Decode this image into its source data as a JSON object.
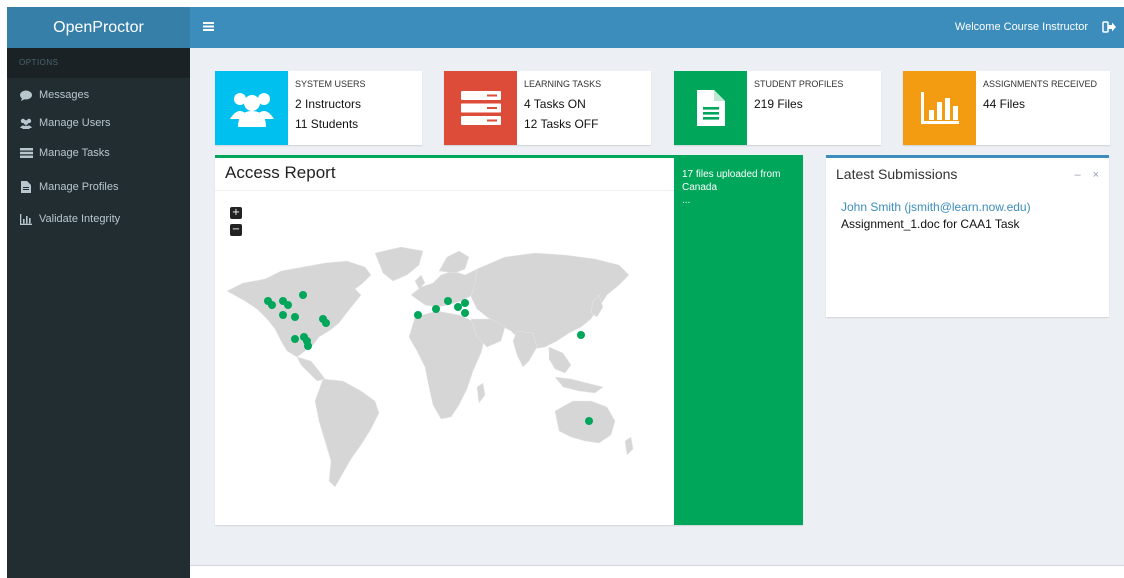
{
  "app": {
    "logo": "OpenProctor",
    "menu_icon": "hamburger-icon",
    "welcome": "Welcome Course Instructor",
    "signout_icon": "sign-out-icon"
  },
  "sidebar": {
    "header": "OPTIONS",
    "items": [
      {
        "label": "Messages",
        "icon": "comment-icon"
      },
      {
        "label": "Manage Users",
        "icon": "users-icon"
      },
      {
        "label": "Manage Tasks",
        "icon": "tasks-icon"
      },
      {
        "label": "Manage Profiles",
        "icon": "file-icon"
      },
      {
        "label": "Validate Integrity",
        "icon": "bar-chart-icon"
      }
    ]
  },
  "info_boxes": [
    {
      "title": "SYSTEM USERS",
      "line1": "2 Instructors",
      "line2": "11 Students",
      "color": "#00c0ef",
      "icon": "users-icon"
    },
    {
      "title": "LEARNING TASKS",
      "line1": "4 Tasks ON",
      "line2": "12 Tasks OFF",
      "color": "#dd4b39",
      "icon": "server-icon"
    },
    {
      "title": "STUDENT PROFILES",
      "line1": "219 Files",
      "line2": "",
      "color": "#00a65a",
      "icon": "file-text-icon"
    },
    {
      "title": "ASSIGNMENTS RECEIVED",
      "line1": "44 Files",
      "line2": "",
      "color": "#f39c12",
      "icon": "bar-chart-icon"
    }
  ],
  "access_report": {
    "title": "Access Report",
    "zoom_in": "+",
    "zoom_out": "−",
    "side_text": "17 files uploaded from Canada",
    "side_more": "...",
    "marker_color": "#00a65a"
  },
  "latest_submissions": {
    "title": "Latest Submissions",
    "name": "John Smith (jsmith@learn.now.edu)",
    "file": "Assignment_1.doc for CAA1 Task"
  },
  "box_tools": "– ×"
}
